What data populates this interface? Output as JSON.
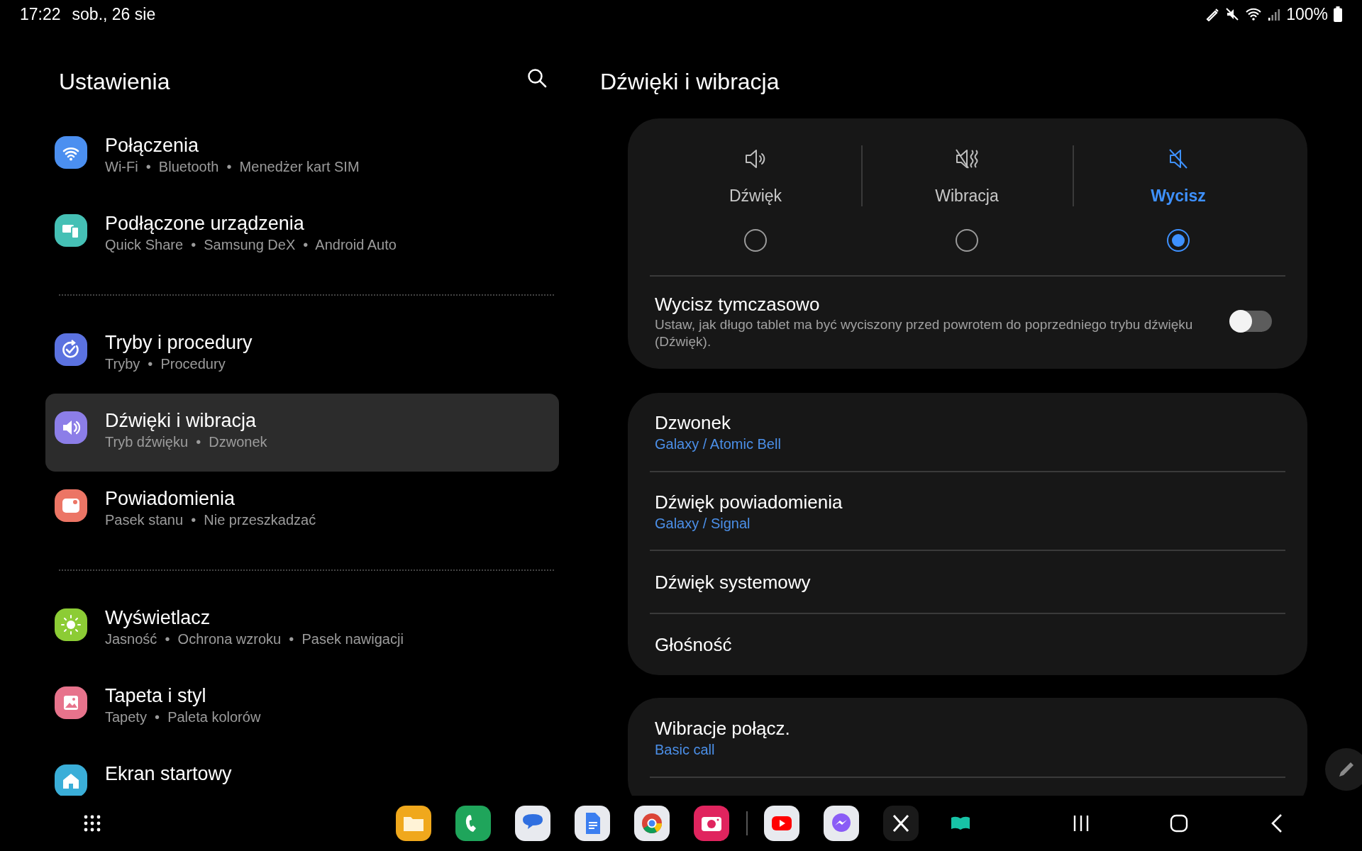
{
  "status_bar": {
    "time": "17:22",
    "date": "sob., 26 sie",
    "battery": "100%"
  },
  "settings": {
    "title": "Ustawienia",
    "groups": [
      {
        "items": [
          {
            "title": "Połączenia",
            "subtitle": "Wi-Fi  •  Bluetooth  •  Menedżer kart SIM",
            "color": "#4b8ff0",
            "selected": false
          },
          {
            "title": "Podłączone urządzenia",
            "subtitle": "Quick Share  •  Samsung DeX  •  Android Auto",
            "color": "#45c0b5",
            "selected": false
          }
        ]
      },
      {
        "items": [
          {
            "title": "Tryby i procedury",
            "subtitle": "Tryby  •  Procedury",
            "color": "#5b72e0",
            "selected": false
          },
          {
            "title": "Dźwięki i wibracja",
            "subtitle": "Tryb dźwięku  •  Dzwonek",
            "color": "#8c7ee8",
            "selected": true
          },
          {
            "title": "Powiadomienia",
            "subtitle": "Pasek stanu  •  Nie przeszkadzać",
            "color": "#ec7565",
            "selected": false
          }
        ]
      },
      {
        "items": [
          {
            "title": "Wyświetlacz",
            "subtitle": "Jasność  •  Ochrona wzroku  •  Pasek nawigacji",
            "color": "#8ccc35",
            "selected": false
          },
          {
            "title": "Tapeta i styl",
            "subtitle": "Tapety  •  Paleta kolorów",
            "color": "#e7738c",
            "selected": false
          },
          {
            "title": "Ekran startowy",
            "color": "#3aaed8",
            "selected": false
          }
        ]
      }
    ]
  },
  "detail": {
    "title": "Dźwięki i wibracja",
    "modes": [
      {
        "label": "Dźwięk",
        "selected": false
      },
      {
        "label": "Wibracja",
        "selected": false
      },
      {
        "label": "Wycisz",
        "selected": true
      }
    ],
    "temp_mute": {
      "title": "Wycisz tymczasowo",
      "description": "Ustaw, jak długo tablet ma być wyciszony przed powrotem do poprzedniego trybu dźwięku (Dźwięk).",
      "on": false
    },
    "sound_items": [
      {
        "title": "Dzwonek",
        "value": "Galaxy / Atomic Bell"
      },
      {
        "title": "Dźwięk powiadomienia",
        "value": "Galaxy / Signal"
      },
      {
        "title": "Dźwięk systemowy"
      },
      {
        "title": "Głośność"
      }
    ],
    "vibration_items": [
      {
        "title": "Wibracje połącz.",
        "value": "Basic call"
      }
    ]
  }
}
